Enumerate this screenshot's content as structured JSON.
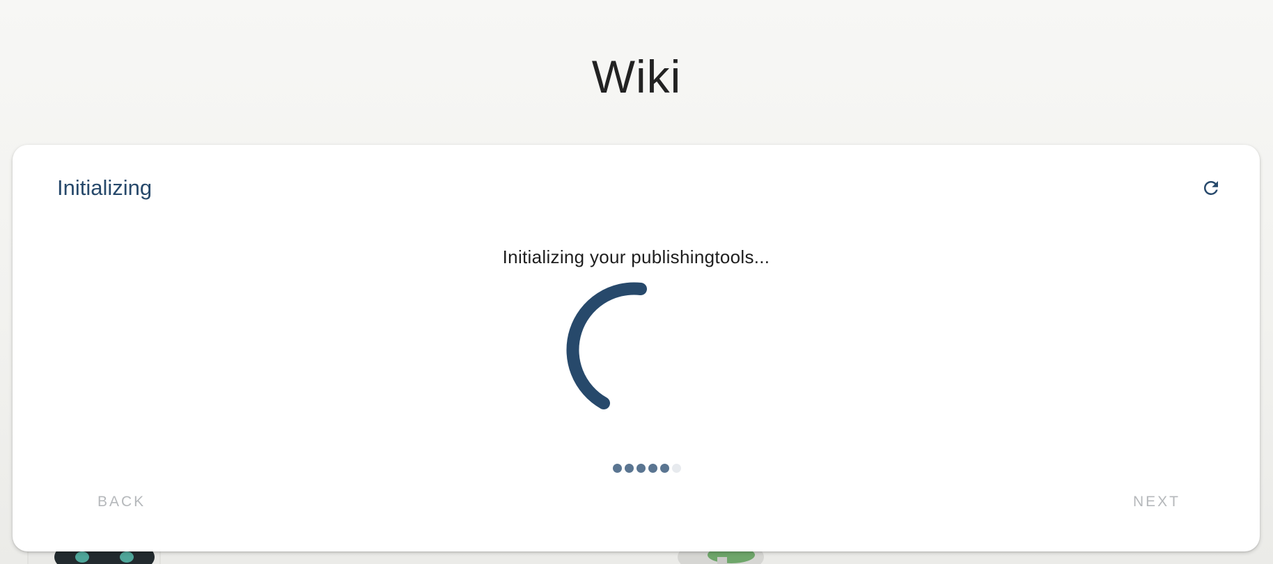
{
  "page": {
    "title": "Wiki"
  },
  "card": {
    "title": "Initializing",
    "status": "Initializing your publishingtools...",
    "progress_steps_total": 6,
    "progress_steps_done": 5
  },
  "navigation": {
    "back_label": "BACK",
    "next_label": "NEXT",
    "back_enabled": false,
    "next_enabled": false
  },
  "icons": {
    "refresh": "refresh-icon",
    "spinner": "loading-spinner"
  },
  "colors": {
    "accent": "#27496b",
    "spinner": "#27496b",
    "dot_active": "#5a7591",
    "dot_inactive": "#e7eaee",
    "disabled_text": "#b5b8bb"
  }
}
